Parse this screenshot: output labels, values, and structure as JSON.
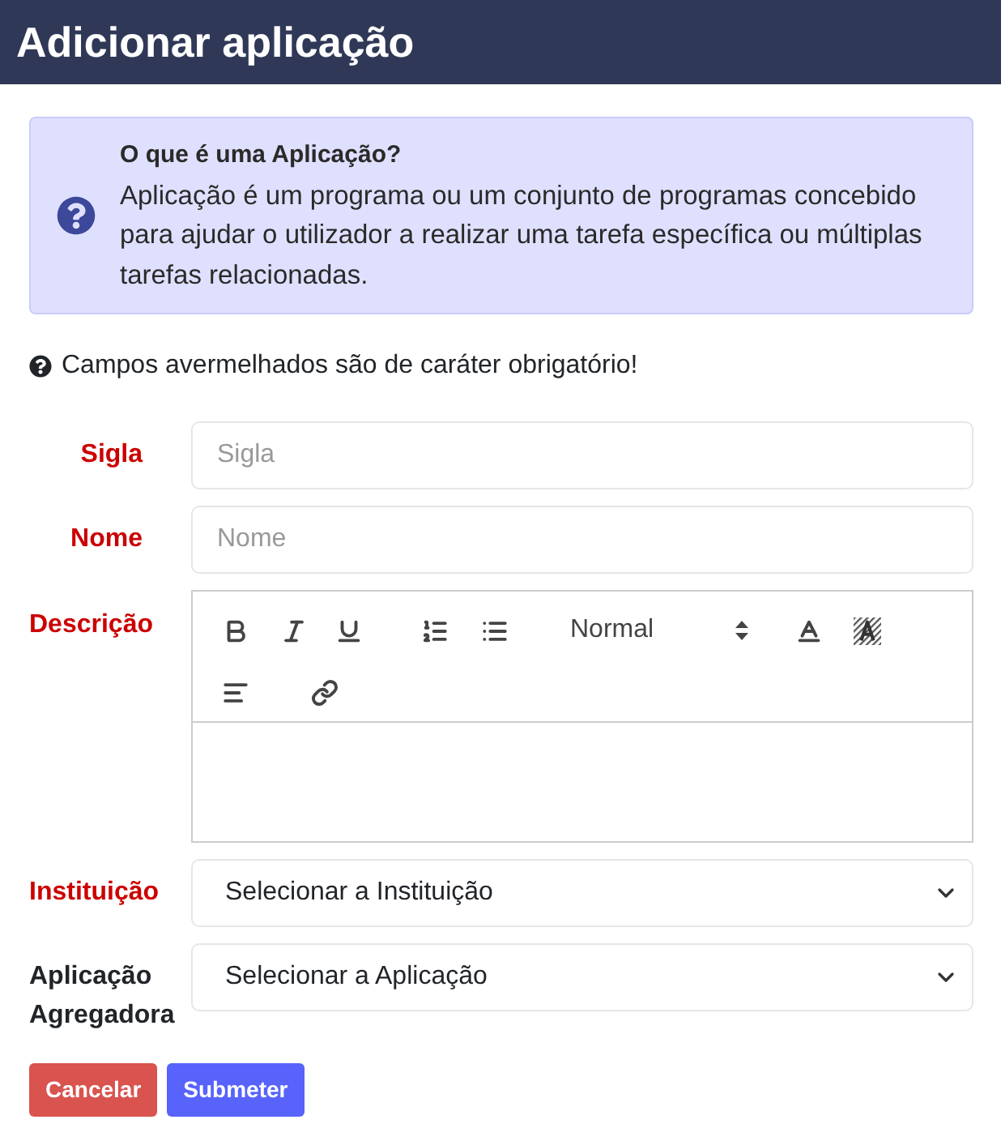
{
  "header": {
    "title": "Adicionar aplicação"
  },
  "info": {
    "title": "O que é uma Aplicação?",
    "text": "Aplicação é um programa ou um conjunto de programas concebido para ajudar o utilizador a realizar uma tarefa específica ou múltiplas tarefas relacionadas."
  },
  "required_note": "Campos avermelhados são de caráter obrigatório!",
  "fields": [
    {
      "kind": "text",
      "label": "Sigla",
      "required": true,
      "placeholder": "Sigla"
    },
    {
      "kind": "text",
      "label": "Nome",
      "required": true,
      "placeholder": "Nome"
    },
    {
      "kind": "editor",
      "label": "Descrição",
      "required": true,
      "header_picker": "Normal"
    },
    {
      "kind": "select",
      "label": "Instituição",
      "required": true,
      "value": "Selecionar a Instituição"
    },
    {
      "kind": "select",
      "label": "Aplicação Agregadora",
      "required": false,
      "value": "Selecionar a Aplicação"
    }
  ],
  "buttons": [
    {
      "kind": "cancel",
      "label": "Cancelar"
    },
    {
      "kind": "submit",
      "label": "Submeter"
    }
  ]
}
